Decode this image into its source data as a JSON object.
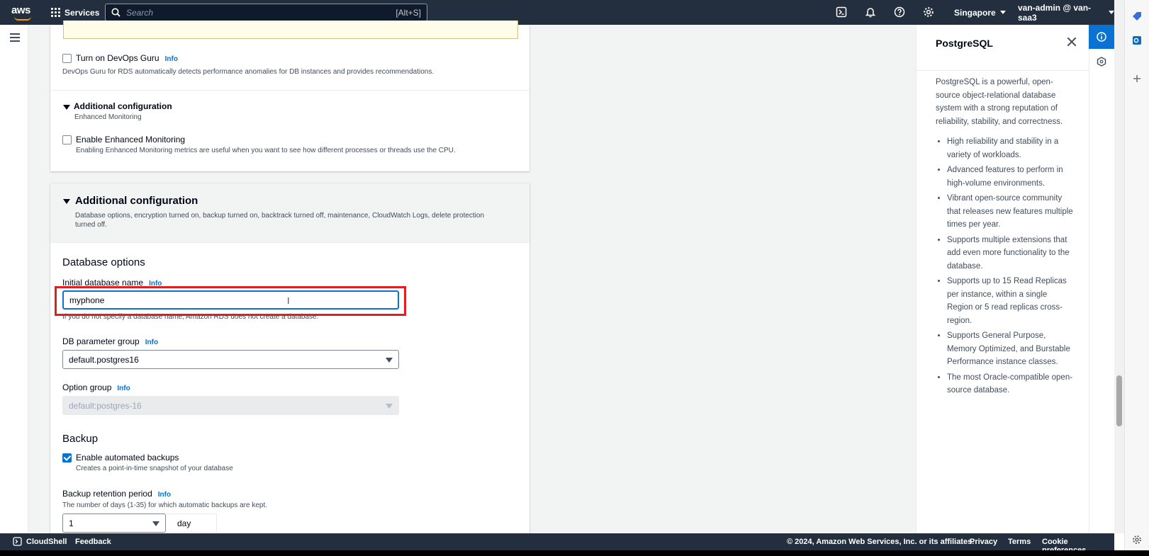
{
  "topnav": {
    "logo_text": "aws",
    "services_label": "Services",
    "search_placeholder": "Search",
    "search_shortcut": "[Alt+S]",
    "region": "Singapore",
    "account": "van-admin @ van-saa3"
  },
  "card1": {
    "devops_label": "Turn on DevOps Guru",
    "devops_info": "Info",
    "devops_desc": "DevOps Guru for RDS automatically detects performance anomalies for DB instances and provides recommendations.",
    "addl_title": "Additional configuration",
    "addl_subtitle": "Enhanced Monitoring",
    "enhanced_label": "Enable Enhanced Monitoring",
    "enhanced_desc": "Enabling Enhanced Monitoring metrics are useful when you want to see how different processes or threads use the CPU."
  },
  "card2": {
    "title": "Additional configuration",
    "desc_line1": "Database options, encryption turned on, backup turned on, backtrack turned off, maintenance, CloudWatch Logs, delete protection",
    "desc_line2": "turned off.",
    "db_options_title": "Database options",
    "initial_db_label": "Initial database name",
    "initial_db_info": "Info",
    "initial_db_value": "myphone",
    "initial_db_hint": "If you do not specify a database name, Amazon RDS does not create a database.",
    "param_group_label": "DB parameter group",
    "param_group_info": "Info",
    "param_group_value": "default.postgres16",
    "option_group_label": "Option group",
    "option_group_info": "Info",
    "option_group_value": "default:postgres-16",
    "backup_title": "Backup",
    "auto_backup_label": "Enable automated backups",
    "auto_backup_desc": "Creates a point-in-time snapshot of your database",
    "retention_label": "Backup retention period",
    "retention_info": "Info",
    "retention_desc": "The number of days (1-35) for which automatic backups are kept.",
    "retention_value": "1",
    "retention_unit": "day"
  },
  "help": {
    "title": "PostgreSQL",
    "intro": "PostgreSQL is a powerful, open-source object-relational database system with a strong reputation of reliability, stability, and correctness.",
    "bullets": [
      "High reliability and stability in a variety of workloads.",
      "Advanced features to perform in high-volume environments.",
      "Vibrant open-source community that releases new features multiple times per year.",
      "Supports multiple extensions that add even more functionality to the database.",
      "Supports up to 15 Read Replicas per instance, within a single Region or 5 read replicas cross-region.",
      "Supports General Purpose, Memory Optimized, and Burstable Performance instance classes.",
      "The most Oracle-compatible open-source database."
    ]
  },
  "footer": {
    "cloudshell": "CloudShell",
    "feedback": "Feedback",
    "copyright": "© 2024, Amazon Web Services, Inc. or its affiliates.",
    "privacy": "Privacy",
    "terms": "Terms",
    "cookie": "Cookie preferences"
  }
}
